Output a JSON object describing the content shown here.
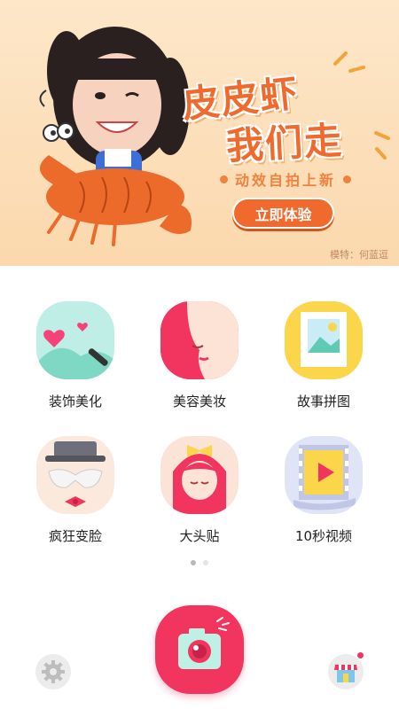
{
  "banner": {
    "title_line1": "皮皮虾",
    "title_line2": "我们走",
    "subtitle": "动效自拍上新",
    "cta": "立即体验",
    "credit": "模特：何蓝逗"
  },
  "features": [
    {
      "label": "装饰美化",
      "icon": "decorate-icon"
    },
    {
      "label": "美容美妆",
      "icon": "beauty-makeup-icon"
    },
    {
      "label": "故事拼图",
      "icon": "collage-icon"
    },
    {
      "label": "疯狂变脸",
      "icon": "face-swap-icon"
    },
    {
      "label": "大头贴",
      "icon": "photo-sticker-icon"
    },
    {
      "label": "10秒视频",
      "icon": "video-icon"
    }
  ],
  "pager": {
    "pages": 2,
    "current": 1
  },
  "bottom": {
    "camera": "camera-icon",
    "settings": "gear-icon",
    "shop": "store-icon",
    "shop_has_badge": true
  },
  "colors": {
    "accent": "#f2355e",
    "banner_orange": "#ef6a2c"
  }
}
